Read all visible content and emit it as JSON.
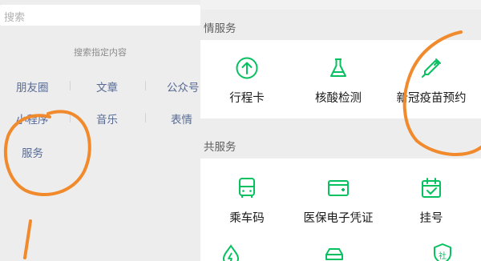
{
  "search": {
    "placeholder": "搜索",
    "hint": "搜索指定内容",
    "categories": [
      "朋友圈",
      "文章",
      "公众号",
      "小程序",
      "音乐",
      "表情",
      "服务"
    ]
  },
  "services": {
    "section1_title": "情服务",
    "section1_items": [
      {
        "label": "行程卡",
        "icon": "arrow-up-circle-icon"
      },
      {
        "label": "核酸检测",
        "icon": "flask-icon"
      },
      {
        "label": "新冠疫苗预约",
        "icon": "syringe-icon"
      }
    ],
    "section2_title": "共服务",
    "section2_items": [
      {
        "label": "乘车码",
        "icon": "bus-icon"
      },
      {
        "label": "医保电子凭证",
        "icon": "medical-card-icon"
      },
      {
        "label": "挂号",
        "icon": "calendar-check-icon"
      }
    ],
    "section2_row2_icons": [
      "electricity-drop-icon",
      "car-icon",
      "shield-social-icon"
    ],
    "shield_glyph": "社"
  },
  "colors": {
    "accent": "#07c160",
    "link": "#576b95",
    "annotation": "#f08a2c"
  }
}
